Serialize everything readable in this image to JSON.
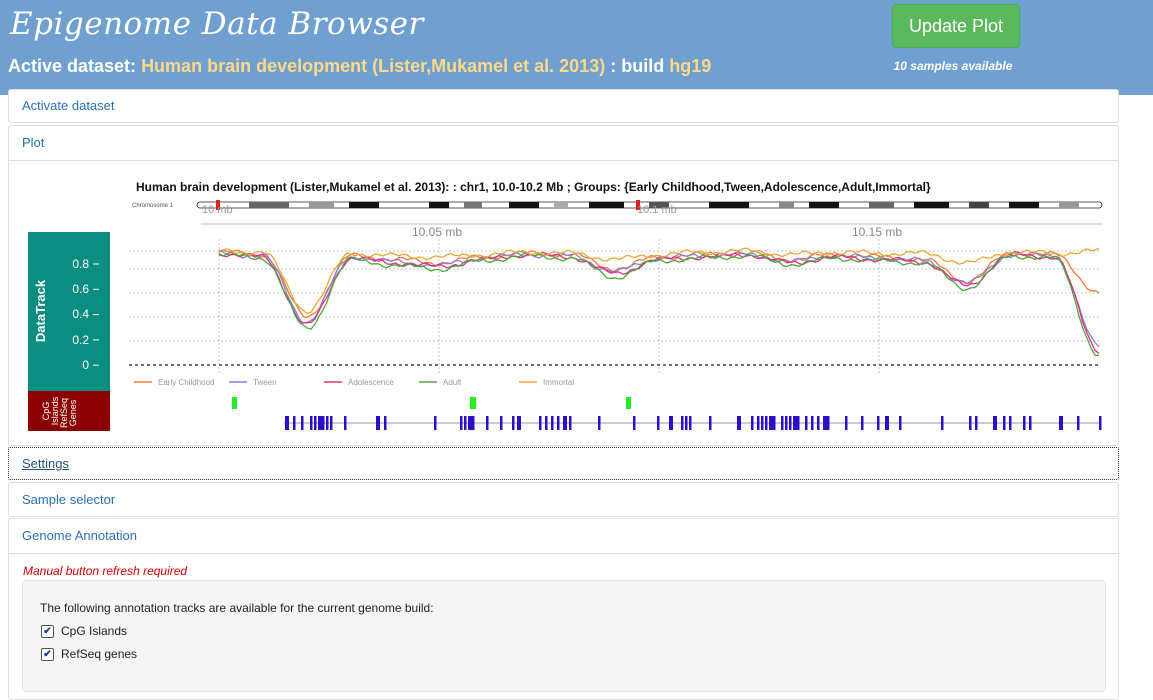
{
  "header": {
    "app_title": "Epigenome Data Browser",
    "active_prefix": "Active dataset: ",
    "dataset_name": "Human brain development (Lister,Mukamel et al. 2013)",
    "build_prefix": " : build ",
    "build": "hg19",
    "update_button": "Update Plot",
    "samples_available": "10 samples available"
  },
  "panels": {
    "activate": "Activate dataset",
    "plot": "Plot",
    "settings": "Settings",
    "sample_selector": "Sample selector",
    "genome_annotation": "Genome Annotation"
  },
  "plot": {
    "title": "Human brain development (Lister,Mukamel et al. 2013): : chr1, 10.0-10.2 Mb ; Groups: {Early Childhood,Tween,Adolescence,Adult,Immortal}",
    "ideogram_label": "Chromosome 1",
    "scale_labels": [
      "10 mb",
      "10.1 mb"
    ],
    "axis_top_labels": [
      "10.05 mb",
      "10.15 mb"
    ],
    "y_ticks": [
      "0.8",
      "0.6",
      "0.4",
      "0.2",
      "0"
    ],
    "track_labels": {
      "data": "DataTrack",
      "cpg": "CpG",
      "cpg_sub": "Islands",
      "refseq": "RefSeq",
      "refseq_sub": "Genes"
    }
  },
  "chart_data": {
    "type": "line",
    "title": "Human brain development (Lister,Mukamel et al. 2013): : chr1, 10.0-10.2 Mb ; Groups: {Early Childhood,Tween,Adolescence,Adult,Immortal}",
    "xlabel": "",
    "ylabel": "DataTrack",
    "ylim": [
      0,
      1
    ],
    "x": [
      10.0,
      10.01,
      10.02,
      10.03,
      10.04,
      10.05,
      10.06,
      10.07,
      10.08,
      10.09,
      10.1,
      10.11,
      10.12,
      10.13,
      10.14,
      10.15,
      10.16,
      10.17,
      10.18,
      10.19,
      10.2
    ],
    "series": [
      {
        "name": "Early Childhood",
        "color": "#f07a3a",
        "values": [
          0.94,
          0.92,
          0.4,
          0.91,
          0.88,
          0.85,
          0.9,
          0.93,
          0.92,
          0.8,
          0.9,
          0.92,
          0.93,
          0.88,
          0.92,
          0.9,
          0.88,
          0.7,
          0.93,
          0.92,
          0.6
        ]
      },
      {
        "name": "Tween",
        "color": "#8c7fd0",
        "values": [
          0.93,
          0.91,
          0.36,
          0.9,
          0.86,
          0.83,
          0.89,
          0.92,
          0.91,
          0.78,
          0.89,
          0.91,
          0.92,
          0.86,
          0.91,
          0.89,
          0.87,
          0.68,
          0.92,
          0.91,
          0.15
        ]
      },
      {
        "name": "Adolescence",
        "color": "#e0308a",
        "values": [
          0.93,
          0.9,
          0.33,
          0.89,
          0.85,
          0.82,
          0.88,
          0.92,
          0.9,
          0.76,
          0.88,
          0.9,
          0.92,
          0.85,
          0.9,
          0.88,
          0.86,
          0.66,
          0.92,
          0.9,
          0.12
        ]
      },
      {
        "name": "Adult",
        "color": "#4aa83a",
        "values": [
          0.92,
          0.89,
          0.3,
          0.88,
          0.83,
          0.8,
          0.87,
          0.91,
          0.89,
          0.73,
          0.87,
          0.89,
          0.91,
          0.84,
          0.89,
          0.87,
          0.85,
          0.64,
          0.91,
          0.89,
          0.08
        ]
      },
      {
        "name": "Immortal",
        "color": "#e8a833",
        "values": [
          0.95,
          0.94,
          0.45,
          0.93,
          0.91,
          0.9,
          0.92,
          0.94,
          0.93,
          0.88,
          0.92,
          0.94,
          0.95,
          0.92,
          0.94,
          0.93,
          0.93,
          0.85,
          0.94,
          0.93,
          0.95
        ]
      }
    ],
    "grid": true,
    "legend": "bottom"
  },
  "annotation": {
    "manual_note": "Manual button refresh required",
    "available_text": "The following annotation tracks are available for the current genome build:",
    "tracks": [
      {
        "label": "CpG Islands",
        "checked": true
      },
      {
        "label": "RefSeq genes",
        "checked": true
      }
    ]
  }
}
